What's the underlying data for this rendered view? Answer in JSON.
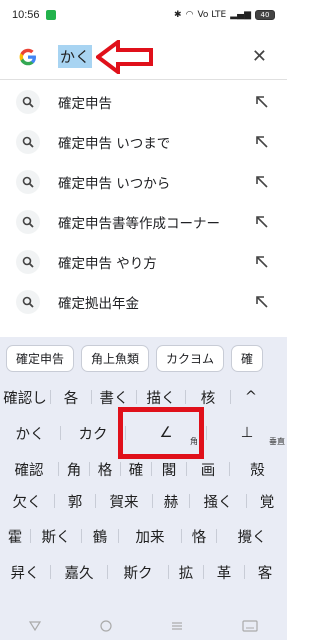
{
  "status": {
    "time": "10:56",
    "network": "Vo LTE",
    "battery": "40"
  },
  "search": {
    "query": "かく",
    "clear_icon": "✕"
  },
  "suggestions": [
    {
      "text": "確定申告"
    },
    {
      "text": "確定申告 いつまで"
    },
    {
      "text": "確定申告 いつから"
    },
    {
      "text": "確定申告書等作成コーナー"
    },
    {
      "text": "確定申告 やり方"
    },
    {
      "text": "確定拠出年金"
    }
  ],
  "keyboard": {
    "chips": [
      "確定申告",
      "角上魚類",
      "カクヨム",
      "確"
    ],
    "rows": [
      [
        "確認し",
        "各",
        "書く",
        "描く",
        "核",
        "^"
      ],
      [
        "かく",
        "カク",
        "∠",
        "⊥"
      ],
      [
        "確認",
        "角",
        "格",
        "確",
        "閣",
        "画",
        "殻"
      ],
      [
        "欠く",
        "郭",
        "賀来",
        "赫",
        "掻く",
        "覚"
      ],
      [
        "霍",
        "斯く",
        "鶴",
        "加来",
        "恪",
        "攪く"
      ],
      [
        "舁く",
        "嘉久",
        "斯ク",
        "拡",
        "革",
        "客"
      ]
    ],
    "sub_labels": {
      "angle": "角",
      "perp": "垂直"
    }
  },
  "colors": {
    "accent_blue": "#a8d4f2",
    "annotation_red": "#e0101a",
    "keyboard_bg": "#e9ecf5"
  }
}
